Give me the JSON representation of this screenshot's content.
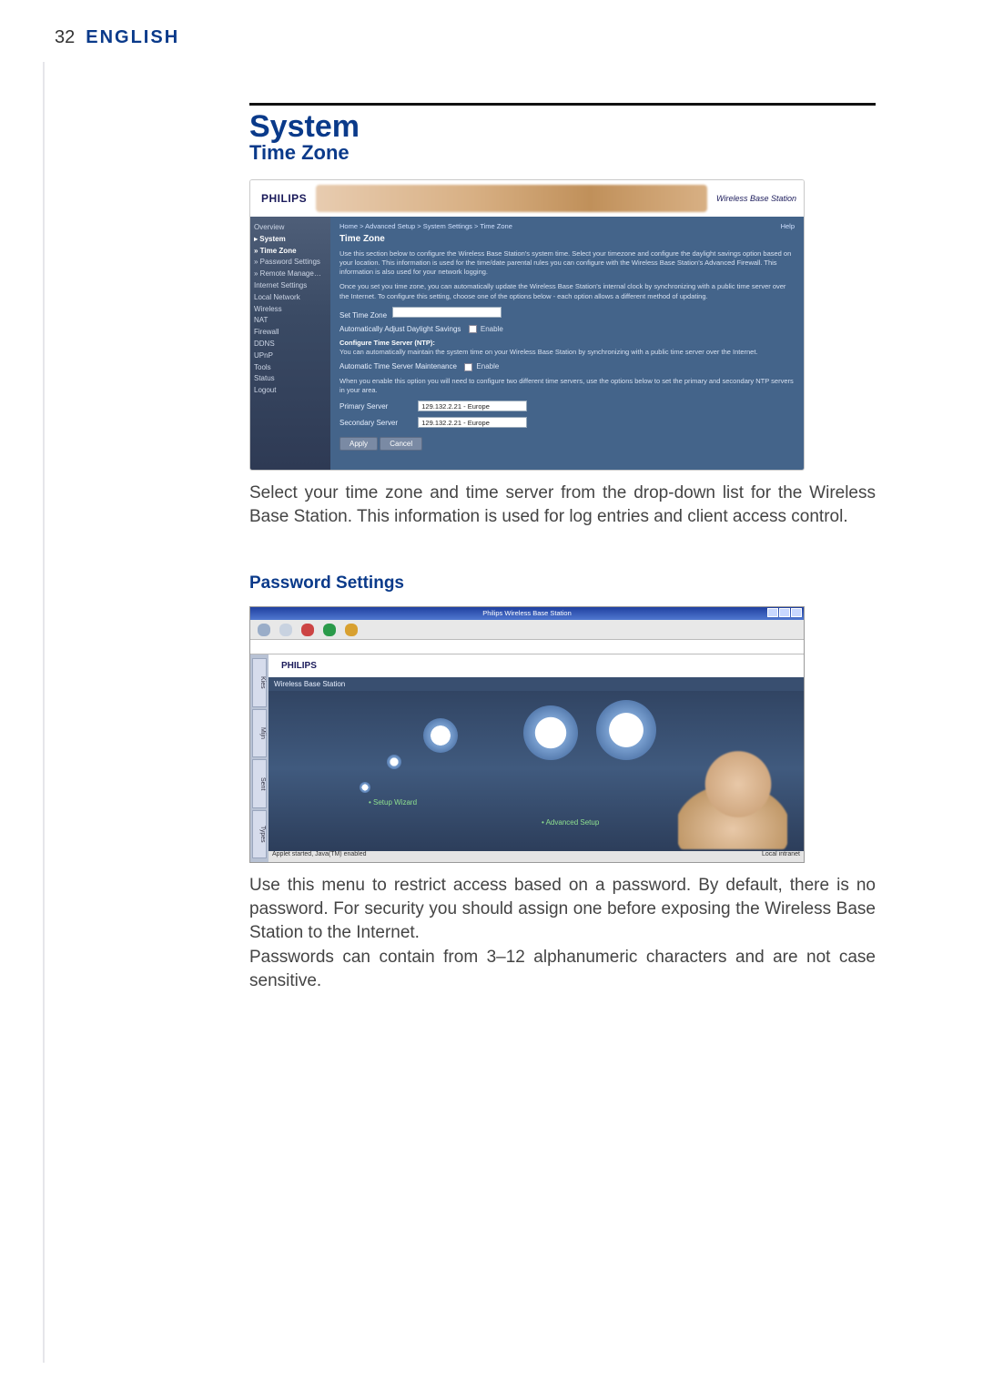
{
  "page_number": "32",
  "page_lang": "ENGLISH",
  "section_title": "System",
  "subsection_title": "Time Zone",
  "tz_shot": {
    "brand": "PHILIPS",
    "header_right": "Wireless Base Station",
    "sidebar": [
      "Overview",
      "▸ System",
      "  » Time Zone",
      "  » Password Settings",
      "  » Remote Management",
      "Internet Settings",
      "Local Network",
      "Wireless",
      "NAT",
      "Firewall",
      "DDNS",
      "UPnP",
      "Tools",
      "Status",
      "Logout"
    ],
    "crumbs": "Home > Advanced Setup > System Settings > Time Zone",
    "help": "Help",
    "panel_title": "Time Zone",
    "p1": "Use this section below to configure the Wireless Base Station's system time. Select your timezone and configure the daylight savings option based on your location. This information is used for the time/date parental rules you can configure with the Wireless Base Station's Advanced Firewall. This information is also used for your network logging.",
    "p2": "Once you set you time zone, you can automatically update the Wireless Base Station's internal clock by synchronizing with a public time server over the Internet. To configure this setting, choose one of the options below - each option allows a different method of updating.",
    "set_tz_label": "Set Time Zone",
    "set_tz_value": "",
    "dst_label": "Automatically Adjust Daylight Savings",
    "dst_enable": "Enable",
    "ntp_title": "Configure Time Server (NTP):",
    "ntp_desc": "You can automatically maintain the system time on your Wireless Base Station by synchronizing with a public time server over the Internet.",
    "auto_maint_label": "Automatic Time Server Maintenance",
    "auto_maint_enable": "Enable",
    "p3": "When you enable this option you will need to configure two different time servers, use the options below to set the primary and secondary NTP servers in your area.",
    "primary_label": "Primary Server",
    "secondary_label": "Secondary Server",
    "server_value": "129.132.2.21 - Europe",
    "apply": "Apply",
    "cancel": "Cancel"
  },
  "tz_para": "Select your time zone and time server from the drop-down list for the Wireless Base Station. This information is used for log entries and client access control.",
  "pw_title": "Password Settings",
  "pw_shot": {
    "window_title": "Philips Wireless Base Station",
    "brand": "PHILIPS",
    "bar_text": "Wireless Base Station",
    "tabs": [
      "Kies",
      "Mijn",
      "Sent",
      "Types"
    ],
    "link_setup": "• Setup Wizard",
    "link_adv": "• Advanced Setup",
    "status_left": "Applet started, Java(TM) enabled",
    "status_right": "Local intranet"
  },
  "pw_para1": "Use this menu to restrict access based on a password. By default, there is no password. For security you should assign one before exposing the Wireless Base Station to the Internet.",
  "pw_para2": "Passwords can contain from 3–12 alphanumeric characters and are not case sensitive."
}
